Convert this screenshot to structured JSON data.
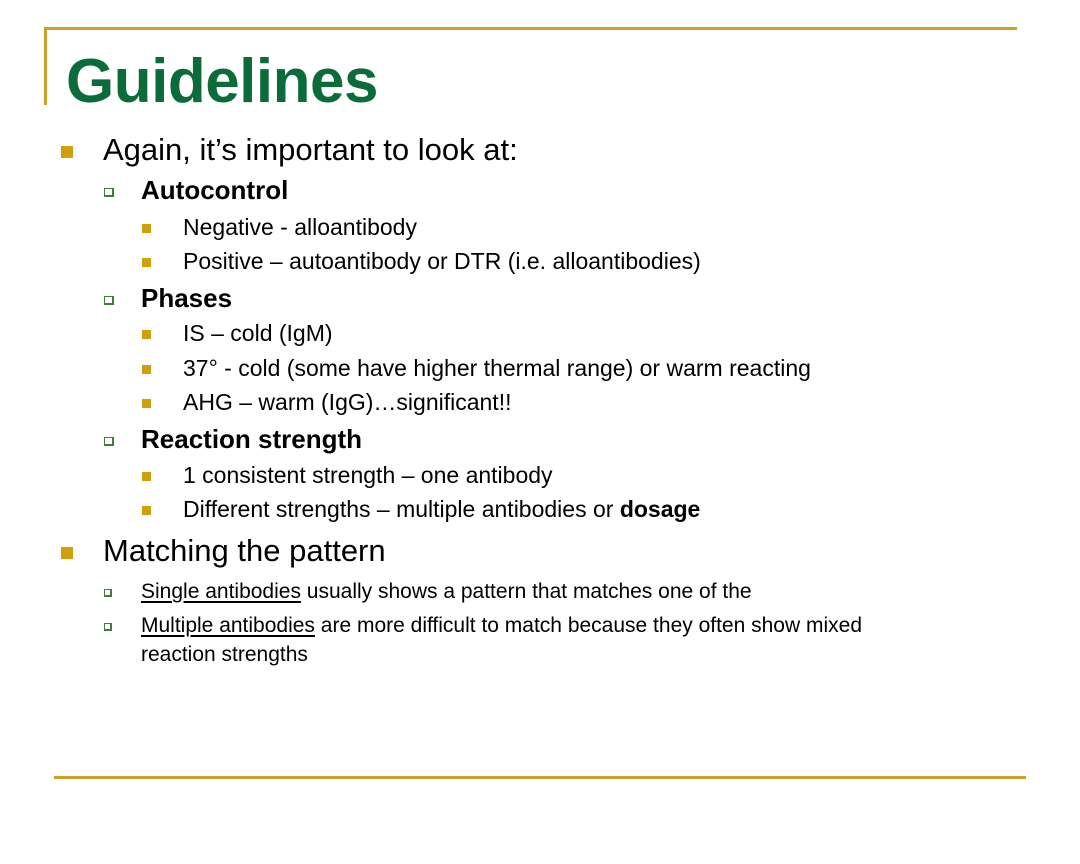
{
  "slide": {
    "title": "Guidelines",
    "bullets": [
      {
        "text": "Again, it’s important to look at:",
        "children": [
          {
            "text": "Autocontrol",
            "children": [
              {
                "text": "Negative - alloantibody"
              },
              {
                "text": "Positive – autoantibody or DTR (i.e. alloantibodies)"
              }
            ]
          },
          {
            "text": "Phases",
            "children": [
              {
                "text": "IS – cold (IgM)"
              },
              {
                "text": "37° - cold (some have higher thermal range) or warm reacting"
              },
              {
                "text": "AHG – warm (IgG)…significant!!"
              }
            ]
          },
          {
            "text": "Reaction strength",
            "children": [
              {
                "text": "1 consistent strength – one antibody"
              },
              {
                "text_before": "Different strengths – multiple antibodies or ",
                "text_bold": "dosage"
              }
            ]
          }
        ]
      },
      {
        "text": "Matching the pattern",
        "children": [
          {
            "underlined": "Single antibodies",
            "rest": " usually shows a pattern that matches one of the"
          },
          {
            "underlined": "Multiple antibodies",
            "rest": " are more difficult to match because they often show mixed",
            "continuation": "reaction strengths"
          }
        ]
      }
    ]
  },
  "colors": {
    "title": "#0b6b3a",
    "rule": "#c9a227",
    "filled_bullet": "#d19e0c",
    "hollow_bullet": "#3f7d3a",
    "text": "#000000"
  }
}
